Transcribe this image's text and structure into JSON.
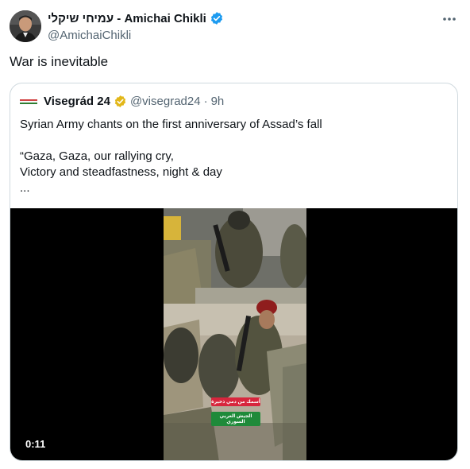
{
  "author": {
    "display_name": "עמיחי שיקלי - Amichai Chikli",
    "handle": "@AmichaiChikli",
    "verified_badge_color": "#1d9bf0"
  },
  "tweet_text": "War is inevitable",
  "menu_icon": "more-horizontal-icon",
  "quoted": {
    "name": "Visegrád 24",
    "handle": "@visegrad24",
    "separator": "·",
    "time": "9h",
    "badge_color": "#e2b719",
    "text_lines": [
      "Syrian Army chants on the first anniversary of Assad’s fall",
      "“Gaza, Gaza, our rallying cry,",
      "Victory and steadfastness, night & day",
      "..."
    ],
    "video": {
      "duration": "0:11",
      "caption_line_1": "أسمك من دمي ذخيرة",
      "caption_line_2": "الجيش العربي السوري"
    }
  }
}
